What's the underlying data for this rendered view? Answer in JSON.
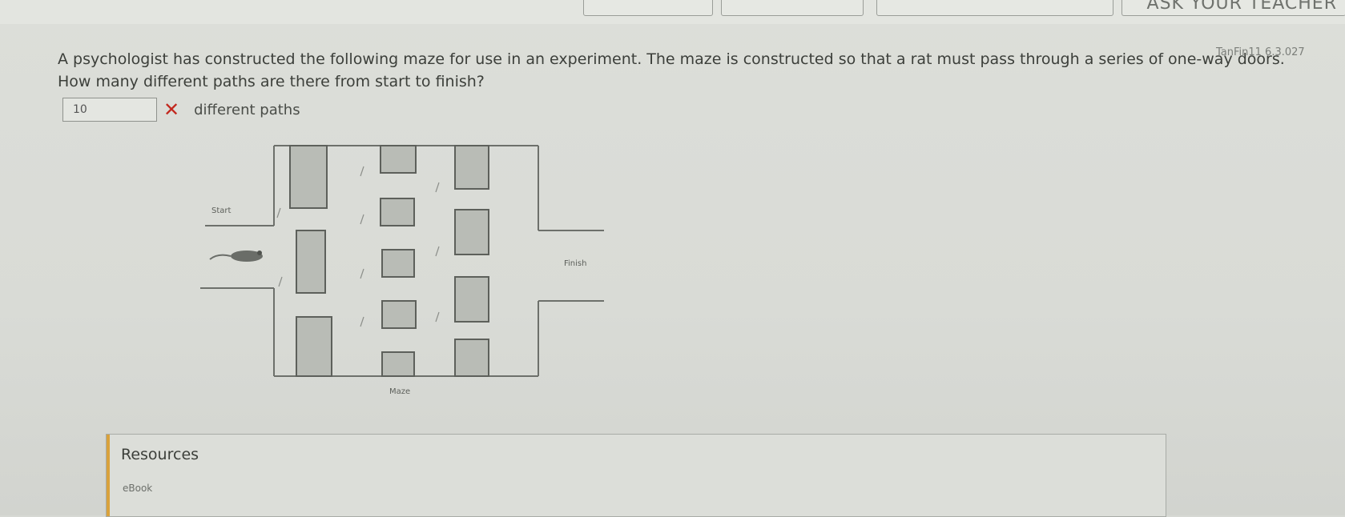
{
  "header": {
    "ask_teacher_label": "ASK YOUR TEACHER"
  },
  "question": {
    "points": "TanFin11 6.3.027",
    "text": "A psychologist has constructed the following maze for use in an experiment. The maze is constructed so that a rat must pass through a series of one-way doors. How many different paths are there from start to finish?",
    "answer_value": "10",
    "answer_status_icon": "x-mark-icon",
    "unit": "different paths"
  },
  "maze": {
    "start_label": "Start",
    "finish_label": "Finish",
    "caption": "Maze"
  },
  "resources": {
    "title": "Resources",
    "link": "eBook"
  },
  "colors": {
    "wrong": "#c2281e",
    "accent": "#d9a23c",
    "text": "#3c3f3a"
  }
}
